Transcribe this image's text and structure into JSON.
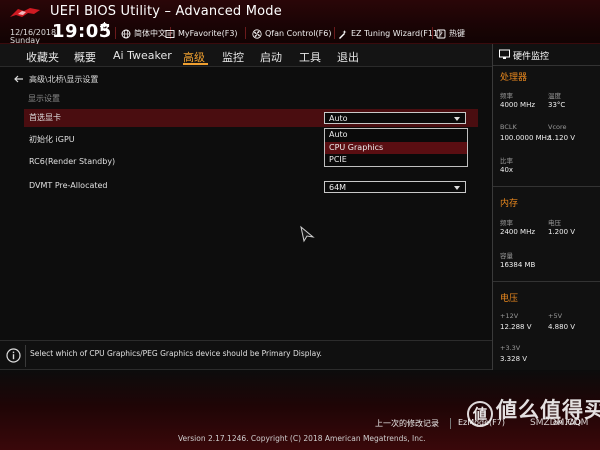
{
  "header": {
    "title": "UEFI BIOS Utility – Advanced Mode",
    "date": "12/16/2018",
    "day": "Sunday",
    "time": "19:05",
    "tools": [
      {
        "icon": "globe-icon",
        "label": "简体中文"
      },
      {
        "icon": "favorite-icon",
        "label": "MyFavorite(F3)"
      },
      {
        "icon": "fan-icon",
        "label": "Qfan Control(F6)"
      },
      {
        "icon": "tuning-icon",
        "label": "EZ Tuning Wizard(F11)"
      },
      {
        "icon": "help-icon",
        "label": "热键"
      }
    ]
  },
  "nav": {
    "tabs": [
      "收藏夹",
      "概要",
      "Ai Tweaker",
      "高级",
      "监控",
      "启动",
      "工具",
      "退出"
    ],
    "active": "高级"
  },
  "main": {
    "breadcrumb": "高级\\北桥\\显示设置",
    "section": "显示设置",
    "settings": [
      {
        "label": "首选显卡",
        "value": "Auto",
        "selected": true
      },
      {
        "label": "初始化 iGPU",
        "value": "",
        "selected": false
      },
      {
        "label": "RC6(Render Standby)",
        "value": "",
        "selected": false
      },
      {
        "label": "DVMT Pre-Allocated",
        "value": "64M",
        "selected": false
      }
    ],
    "dropdown": {
      "options": [
        "Auto",
        "CPU Graphics",
        "PCIE"
      ],
      "highlighted": "CPU Graphics"
    }
  },
  "help": {
    "text": "Select which of CPU Graphics/PEG Graphics device should be Primary Display."
  },
  "footer": {
    "last_modified": "上一次的修改记录",
    "ezmode": "EzMode(F7)",
    "search_faq": "on FAQ",
    "version": "Version 2.17.1246. Copyright (C) 2018 American Megatrends, Inc.",
    "watermark": "値么值得买",
    "watermark_sub": "SMZDM.COM"
  },
  "sidebar": {
    "title": "硬件监控",
    "cpu": {
      "heading": "处理器",
      "freq_label": "频率",
      "freq_value": "4000 MHz",
      "temp_label": "温度",
      "temp_value": "33°C",
      "bclk_label": "BCLK",
      "bclk_value": "100.0000 MHz",
      "vcore_label": "Vcore",
      "vcore_value": "1.120 V",
      "ratio_label": "比率",
      "ratio_value": "40x"
    },
    "memory": {
      "heading": "内存",
      "freq_label": "频率",
      "freq_value": "2400 MHz",
      "volt_label": "电压",
      "volt_value": "1.200 V",
      "cap_label": "容量",
      "cap_value": "16384 MB"
    },
    "voltage": {
      "heading": "电压",
      "v12_label": "+12V",
      "v12_value": "12.288 V",
      "v5_label": "+5V",
      "v5_value": "4.880 V",
      "v33_label": "+3.3V",
      "v33_value": "3.328 V"
    }
  },
  "colors": {
    "accent": "#f0a030",
    "section_heading": "#e9881e",
    "selection": "#4a0d10",
    "header_red": "#2a0608"
  }
}
